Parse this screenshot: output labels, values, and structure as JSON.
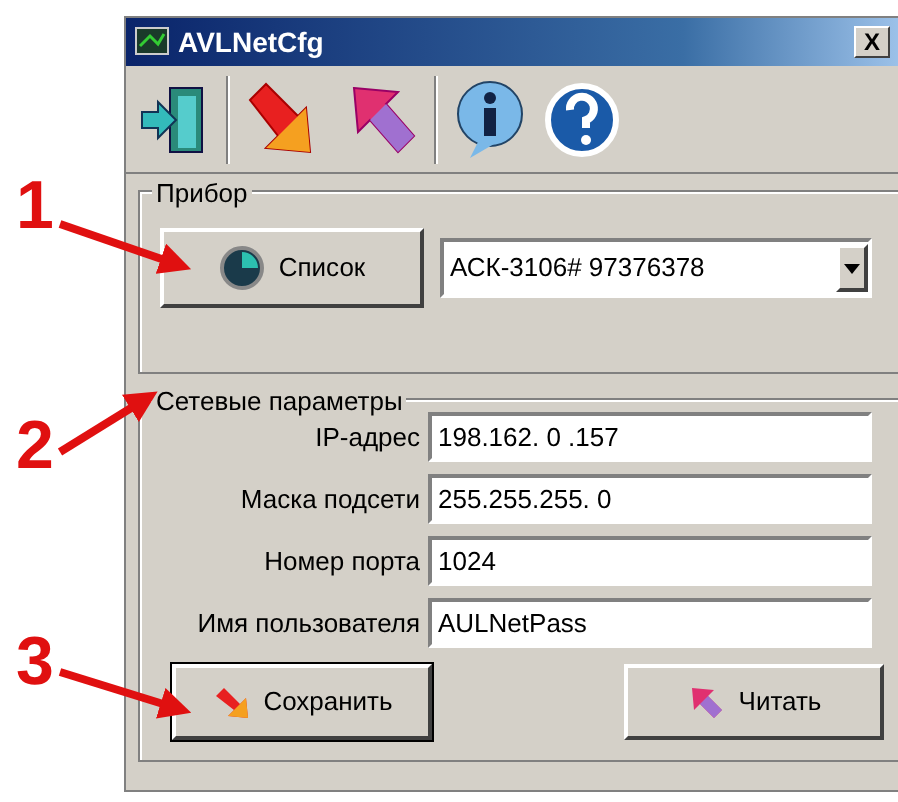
{
  "window": {
    "title": "AVLNetCfg",
    "close": "X"
  },
  "device_group": {
    "label": "Прибор",
    "list_button": "Список",
    "device_select": {
      "value": "АСК-3106# 97376378"
    }
  },
  "network_group": {
    "label": "Сетевые параметры",
    "fields": [
      {
        "label": "IP-адрес",
        "value": "198.162. 0 .157"
      },
      {
        "label": "Маска подсети",
        "value": "255.255.255. 0"
      },
      {
        "label": "Номер порта",
        "value": "1024"
      },
      {
        "label": "Имя пользователя",
        "value": "AULNetPass"
      }
    ],
    "buttons": [
      {
        "label": "Сохранить",
        "kind": "save",
        "focused": true
      },
      {
        "label": "Читать",
        "kind": "read",
        "focused": false
      }
    ]
  },
  "callouts": [
    "1",
    "2",
    "3"
  ]
}
